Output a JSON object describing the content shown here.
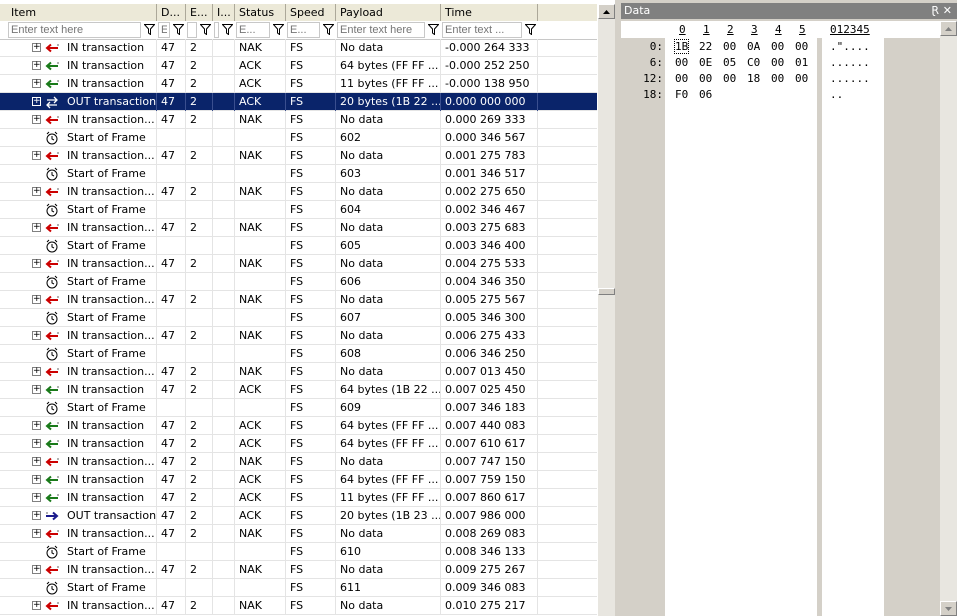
{
  "grid": {
    "columns": [
      {
        "key": "item",
        "label": "Item",
        "placeholder": "Enter text here"
      },
      {
        "key": "dev",
        "label": "D...",
        "placeholder": "E"
      },
      {
        "key": "ep",
        "label": "E...",
        "placeholder": ""
      },
      {
        "key": "intf",
        "label": "I...",
        "placeholder": ""
      },
      {
        "key": "status",
        "label": "Status",
        "placeholder": "E..."
      },
      {
        "key": "speed",
        "label": "Speed",
        "placeholder": "E..."
      },
      {
        "key": "payload",
        "label": "Payload",
        "placeholder": "Enter text here"
      },
      {
        "key": "time",
        "label": "Time",
        "placeholder": "Enter text ..."
      }
    ],
    "rows": [
      {
        "type": "in-nak",
        "item": "IN transaction",
        "dev": "47",
        "ep": "2",
        "status": "NAK",
        "speed": "FS",
        "payload": "No data",
        "time": "-0.000 264 333"
      },
      {
        "type": "in-ack",
        "item": "IN transaction",
        "dev": "47",
        "ep": "2",
        "status": "ACK",
        "speed": "FS",
        "payload": "64 bytes (FF FF ...",
        "time": "-0.000 252 250"
      },
      {
        "type": "in-ack",
        "item": "IN transaction",
        "dev": "47",
        "ep": "2",
        "status": "ACK",
        "speed": "FS",
        "payload": "11 bytes (FF FF ...",
        "time": "-0.000 138 950"
      },
      {
        "type": "out-sel",
        "item": "OUT transaction",
        "dev": "47",
        "ep": "2",
        "status": "ACK",
        "speed": "FS",
        "payload": "20 bytes (1B 22 ...",
        "time": "0.000 000 000",
        "selected": true
      },
      {
        "type": "in-nak",
        "item": "IN transaction...",
        "dev": "47",
        "ep": "2",
        "status": "NAK",
        "speed": "FS",
        "payload": "No data",
        "time": "0.000 269 333"
      },
      {
        "type": "sof",
        "item": "Start of Frame",
        "dev": "",
        "ep": "",
        "status": "",
        "speed": "FS",
        "payload": "602",
        "time": "0.000 346 567"
      },
      {
        "type": "in-nak",
        "item": "IN transaction...",
        "dev": "47",
        "ep": "2",
        "status": "NAK",
        "speed": "FS",
        "payload": "No data",
        "time": "0.001 275 783"
      },
      {
        "type": "sof",
        "item": "Start of Frame",
        "dev": "",
        "ep": "",
        "status": "",
        "speed": "FS",
        "payload": "603",
        "time": "0.001 346 517"
      },
      {
        "type": "in-nak",
        "item": "IN transaction...",
        "dev": "47",
        "ep": "2",
        "status": "NAK",
        "speed": "FS",
        "payload": "No data",
        "time": "0.002 275 650"
      },
      {
        "type": "sof",
        "item": "Start of Frame",
        "dev": "",
        "ep": "",
        "status": "",
        "speed": "FS",
        "payload": "604",
        "time": "0.002 346 467"
      },
      {
        "type": "in-nak",
        "item": "IN transaction...",
        "dev": "47",
        "ep": "2",
        "status": "NAK",
        "speed": "FS",
        "payload": "No data",
        "time": "0.003 275 683"
      },
      {
        "type": "sof",
        "item": "Start of Frame",
        "dev": "",
        "ep": "",
        "status": "",
        "speed": "FS",
        "payload": "605",
        "time": "0.003 346 400"
      },
      {
        "type": "in-nak",
        "item": "IN transaction...",
        "dev": "47",
        "ep": "2",
        "status": "NAK",
        "speed": "FS",
        "payload": "No data",
        "time": "0.004 275 533"
      },
      {
        "type": "sof",
        "item": "Start of Frame",
        "dev": "",
        "ep": "",
        "status": "",
        "speed": "FS",
        "payload": "606",
        "time": "0.004 346 350"
      },
      {
        "type": "in-nak",
        "item": "IN transaction...",
        "dev": "47",
        "ep": "2",
        "status": "NAK",
        "speed": "FS",
        "payload": "No data",
        "time": "0.005 275 567"
      },
      {
        "type": "sof",
        "item": "Start of Frame",
        "dev": "",
        "ep": "",
        "status": "",
        "speed": "FS",
        "payload": "607",
        "time": "0.005 346 300"
      },
      {
        "type": "in-nak",
        "item": "IN transaction...",
        "dev": "47",
        "ep": "2",
        "status": "NAK",
        "speed": "FS",
        "payload": "No data",
        "time": "0.006 275 433"
      },
      {
        "type": "sof",
        "item": "Start of Frame",
        "dev": "",
        "ep": "",
        "status": "",
        "speed": "FS",
        "payload": "608",
        "time": "0.006 346 250"
      },
      {
        "type": "in-nak",
        "item": "IN transaction...",
        "dev": "47",
        "ep": "2",
        "status": "NAK",
        "speed": "FS",
        "payload": "No data",
        "time": "0.007 013 450"
      },
      {
        "type": "in-ack",
        "item": "IN transaction",
        "dev": "47",
        "ep": "2",
        "status": "ACK",
        "speed": "FS",
        "payload": "64 bytes (1B 22 ...",
        "time": "0.007 025 450"
      },
      {
        "type": "sof",
        "item": "Start of Frame",
        "dev": "",
        "ep": "",
        "status": "",
        "speed": "FS",
        "payload": "609",
        "time": "0.007 346 183"
      },
      {
        "type": "in-ack",
        "item": "IN transaction",
        "dev": "47",
        "ep": "2",
        "status": "ACK",
        "speed": "FS",
        "payload": "64 bytes (FF FF ...",
        "time": "0.007 440 083"
      },
      {
        "type": "in-ack",
        "item": "IN transaction",
        "dev": "47",
        "ep": "2",
        "status": "ACK",
        "speed": "FS",
        "payload": "64 bytes (FF FF ...",
        "time": "0.007 610 617"
      },
      {
        "type": "in-nak",
        "item": "IN transaction...",
        "dev": "47",
        "ep": "2",
        "status": "NAK",
        "speed": "FS",
        "payload": "No data",
        "time": "0.007 747 150"
      },
      {
        "type": "in-ack",
        "item": "IN transaction",
        "dev": "47",
        "ep": "2",
        "status": "ACK",
        "speed": "FS",
        "payload": "64 bytes (FF FF ...",
        "time": "0.007 759 150"
      },
      {
        "type": "in-ack",
        "item": "IN transaction",
        "dev": "47",
        "ep": "2",
        "status": "ACK",
        "speed": "FS",
        "payload": "11 bytes (FF FF ...",
        "time": "0.007 860 617"
      },
      {
        "type": "out",
        "item": "OUT transaction",
        "dev": "47",
        "ep": "2",
        "status": "ACK",
        "speed": "FS",
        "payload": "20 bytes (1B 23 ...",
        "time": "0.007 986 000"
      },
      {
        "type": "in-nak",
        "item": "IN transaction...",
        "dev": "47",
        "ep": "2",
        "status": "NAK",
        "speed": "FS",
        "payload": "No data",
        "time": "0.008 269 083"
      },
      {
        "type": "sof",
        "item": "Start of Frame",
        "dev": "",
        "ep": "",
        "status": "",
        "speed": "FS",
        "payload": "610",
        "time": "0.008 346 133"
      },
      {
        "type": "in-nak",
        "item": "IN transaction...",
        "dev": "47",
        "ep": "2",
        "status": "NAK",
        "speed": "FS",
        "payload": "No data",
        "time": "0.009 275 267"
      },
      {
        "type": "sof",
        "item": "Start of Frame",
        "dev": "",
        "ep": "",
        "status": "",
        "speed": "FS",
        "payload": "611",
        "time": "0.009 346 083"
      },
      {
        "type": "in-nak",
        "item": "IN transaction...",
        "dev": "47",
        "ep": "2",
        "status": "NAK",
        "speed": "FS",
        "payload": "No data",
        "time": "0.010 275 217"
      }
    ]
  },
  "data_panel": {
    "title": "Data",
    "pin_glyph": "Ɽ",
    "close_glyph": "✕",
    "hex_header": [
      "0",
      "1",
      "2",
      "3",
      "4",
      "5"
    ],
    "ascii_header": "012345",
    "lines": [
      {
        "offset": "0:",
        "bytes": [
          "1B",
          "22",
          "00",
          "0A",
          "00",
          "00"
        ],
        "ascii": ".\"...."
      },
      {
        "offset": "6:",
        "bytes": [
          "00",
          "0E",
          "05",
          "C0",
          "00",
          "01"
        ],
        "ascii": "......"
      },
      {
        "offset": "12:",
        "bytes": [
          "00",
          "00",
          "00",
          "18",
          "00",
          "00"
        ],
        "ascii": "......"
      },
      {
        "offset": "18:",
        "bytes": [
          "F0",
          "06"
        ],
        "ascii": ".."
      }
    ]
  },
  "colors": {
    "selection": "#0a246a",
    "in_ack_arrow": "#1a7a1a",
    "in_nak_arrow": "#cc0000",
    "out_arrow": "#1a1a8c"
  }
}
